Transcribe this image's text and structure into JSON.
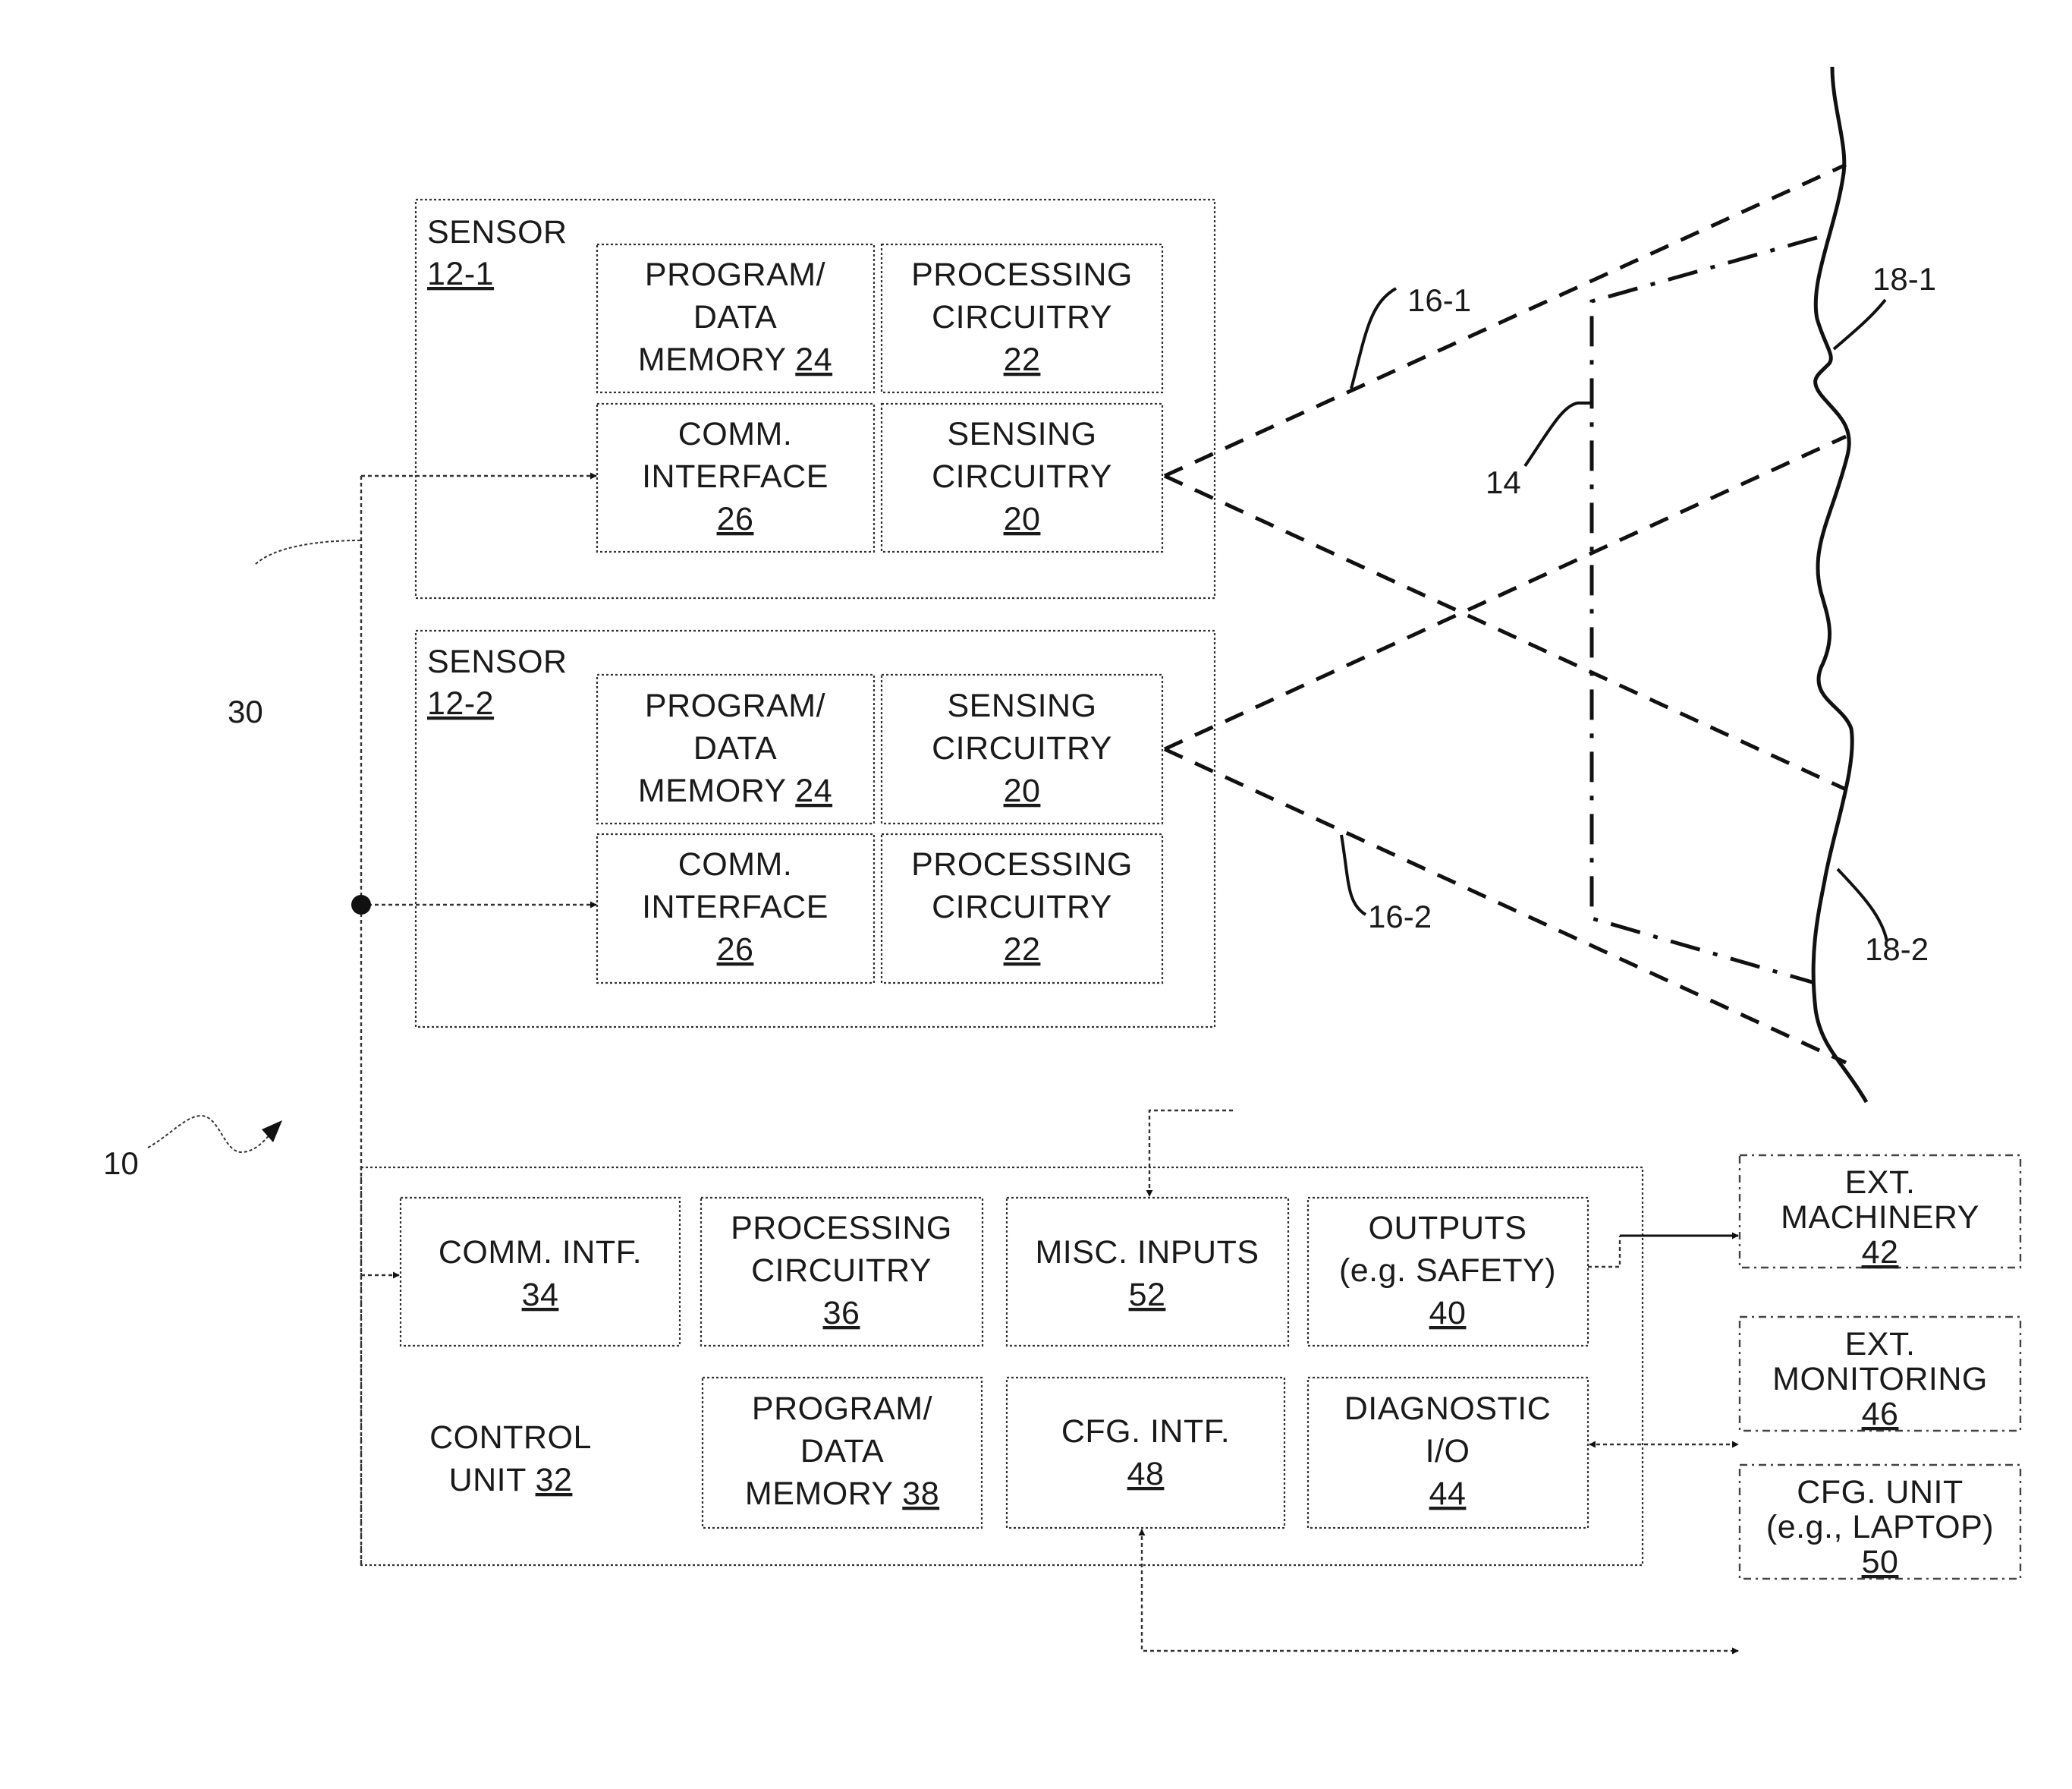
{
  "figure": {
    "system_ref": "10",
    "bus_ref": "30",
    "boundary_ref": "14",
    "fov_refs": [
      "16-1",
      "16-2"
    ],
    "surface_refs": [
      "18-1",
      "18-2"
    ]
  },
  "sensors": [
    {
      "title": "SENSOR",
      "ref": "12-1",
      "blocks": [
        {
          "lines": [
            "PROGRAM/",
            "DATA"
          ],
          "last_line": "MEMORY ",
          "ref": "24"
        },
        {
          "lines": [
            "PROCESSING",
            "CIRCUITRY"
          ],
          "last_line": "",
          "ref": "22"
        },
        {
          "lines": [
            "COMM.",
            "INTERFACE"
          ],
          "last_line": "",
          "ref": "26"
        },
        {
          "lines": [
            "SENSING",
            "CIRCUITRY"
          ],
          "last_line": "",
          "ref": "20"
        }
      ]
    },
    {
      "title": "SENSOR",
      "ref": "12-2",
      "blocks": [
        {
          "lines": [
            "PROGRAM/",
            "DATA"
          ],
          "last_line": "MEMORY ",
          "ref": "24"
        },
        {
          "lines": [
            "SENSING",
            "CIRCUITRY"
          ],
          "last_line": "",
          "ref": "20"
        },
        {
          "lines": [
            "COMM.",
            "INTERFACE"
          ],
          "last_line": "",
          "ref": "26"
        },
        {
          "lines": [
            "PROCESSING",
            "CIRCUITRY"
          ],
          "last_line": "",
          "ref": "22"
        }
      ]
    }
  ],
  "control_unit": {
    "label_line1": "CONTROL",
    "label_line2": "UNIT ",
    "ref": "32",
    "blocks": [
      {
        "lines": [
          "COMM. INTF."
        ],
        "last_line": "",
        "ref": "34"
      },
      {
        "lines": [
          "PROCESSING",
          "CIRCUITRY"
        ],
        "last_line": "",
        "ref": "36"
      },
      {
        "lines": [
          "MISC. INPUTS"
        ],
        "last_line": "",
        "ref": "52"
      },
      {
        "lines": [
          "OUTPUTS",
          "(e.g. SAFETY)"
        ],
        "last_line": "",
        "ref": "40"
      },
      {
        "lines": [
          "PROGRAM/",
          "DATA"
        ],
        "last_line": "MEMORY ",
        "ref": "38"
      },
      {
        "lines": [
          "CFG. INTF."
        ],
        "last_line": "",
        "ref": "48"
      },
      {
        "lines": [
          "DIAGNOSTIC",
          "I/O"
        ],
        "last_line": "",
        "ref": "44"
      }
    ]
  },
  "external": [
    {
      "lines": [
        "EXT.",
        "MACHINERY"
      ],
      "ref": "42"
    },
    {
      "lines": [
        "EXT.",
        "MONITORING"
      ],
      "ref": "46"
    },
    {
      "lines": [
        "CFG. UNIT",
        "(e.g., LAPTOP)"
      ],
      "ref": "50"
    }
  ]
}
